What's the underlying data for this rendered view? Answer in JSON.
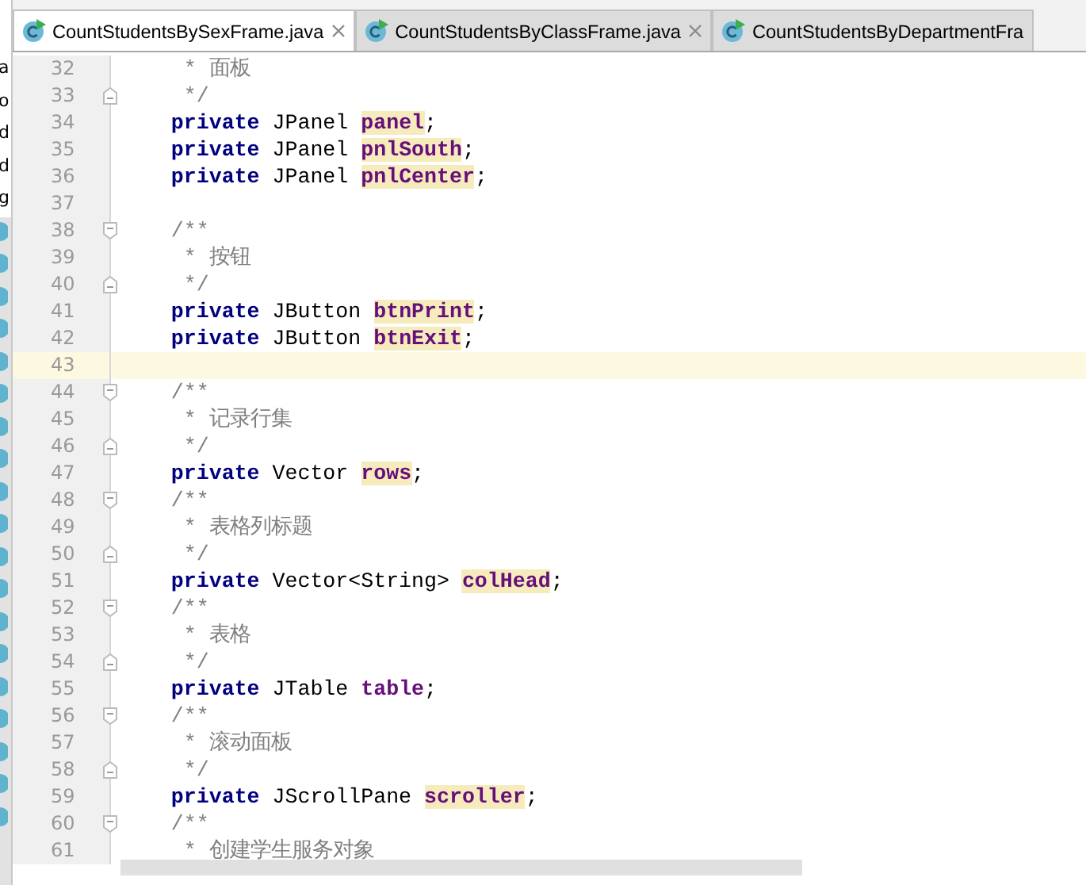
{
  "project_panel": {
    "items": [
      {
        "kind": "text",
        "label": "a"
      },
      {
        "kind": "text",
        "label": "o"
      },
      {
        "kind": "text",
        "label": "d"
      },
      {
        "kind": "text",
        "label": "d"
      },
      {
        "kind": "text",
        "label": "g"
      },
      {
        "kind": "icon"
      },
      {
        "kind": "icon"
      },
      {
        "kind": "icon"
      },
      {
        "kind": "icon"
      },
      {
        "kind": "icon"
      },
      {
        "kind": "icon"
      },
      {
        "kind": "icon"
      },
      {
        "kind": "icon"
      },
      {
        "kind": "icon"
      },
      {
        "kind": "icon"
      },
      {
        "kind": "icon"
      },
      {
        "kind": "icon"
      },
      {
        "kind": "icon"
      },
      {
        "kind": "icon"
      },
      {
        "kind": "icon"
      },
      {
        "kind": "icon"
      },
      {
        "kind": "icon"
      },
      {
        "kind": "icon"
      },
      {
        "kind": "icon"
      }
    ]
  },
  "tabs": [
    {
      "label": "CountStudentsBySexFrame.java",
      "selected": true,
      "closable": true
    },
    {
      "label": "CountStudentsByClassFrame.java",
      "selected": false,
      "closable": true
    },
    {
      "label": "CountStudentsByDepartmentFra",
      "selected": false,
      "closable": false
    }
  ],
  "lines": [
    {
      "number": "32",
      "current": false,
      "fold_start": false,
      "fold_end": false,
      "tokens": [
        {
          "kind": "comment",
          "text": "     * 面板"
        }
      ]
    },
    {
      "number": "33",
      "current": false,
      "fold_start": false,
      "fold_end": true,
      "tokens": [
        {
          "kind": "comment",
          "text": "     */"
        }
      ]
    },
    {
      "number": "34",
      "current": false,
      "fold_start": false,
      "fold_end": false,
      "tokens": [
        {
          "kind": "keyword",
          "text": "    private"
        },
        {
          "kind": "text",
          "text": " JPanel "
        },
        {
          "kind": "field-hl",
          "text": "panel"
        },
        {
          "kind": "text",
          "text": ";"
        }
      ]
    },
    {
      "number": "35",
      "current": false,
      "fold_start": false,
      "fold_end": false,
      "tokens": [
        {
          "kind": "keyword",
          "text": "    private"
        },
        {
          "kind": "text",
          "text": " JPanel "
        },
        {
          "kind": "field-hl",
          "text": "pnlSouth"
        },
        {
          "kind": "text",
          "text": ";"
        }
      ]
    },
    {
      "number": "36",
      "current": false,
      "fold_start": false,
      "fold_end": false,
      "tokens": [
        {
          "kind": "keyword",
          "text": "    private"
        },
        {
          "kind": "text",
          "text": " JPanel "
        },
        {
          "kind": "field-hl",
          "text": "pnlCenter"
        },
        {
          "kind": "text",
          "text": ";"
        }
      ]
    },
    {
      "number": "37",
      "current": false,
      "fold_start": false,
      "fold_end": false
    },
    {
      "number": "38",
      "current": false,
      "fold_start": true,
      "fold_end": false,
      "tokens": [
        {
          "kind": "comment",
          "text": "    /**"
        }
      ]
    },
    {
      "number": "39",
      "current": false,
      "fold_start": false,
      "fold_end": false,
      "tokens": [
        {
          "kind": "comment",
          "text": "     * 按钮"
        }
      ]
    },
    {
      "number": "40",
      "current": false,
      "fold_start": false,
      "fold_end": true,
      "tokens": [
        {
          "kind": "comment",
          "text": "     */"
        }
      ]
    },
    {
      "number": "41",
      "current": false,
      "fold_start": false,
      "fold_end": false,
      "tokens": [
        {
          "kind": "keyword",
          "text": "    private"
        },
        {
          "kind": "text",
          "text": " JButton "
        },
        {
          "kind": "field-hl",
          "text": "btnPrint"
        },
        {
          "kind": "text",
          "text": ";"
        }
      ]
    },
    {
      "number": "42",
      "current": false,
      "fold_start": false,
      "fold_end": false,
      "tokens": [
        {
          "kind": "keyword",
          "text": "    private"
        },
        {
          "kind": "text",
          "text": " JButton "
        },
        {
          "kind": "field-hl",
          "text": "btnExit"
        },
        {
          "kind": "text",
          "text": ";"
        }
      ]
    },
    {
      "number": "43",
      "current": true,
      "fold_start": false,
      "fold_end": false
    },
    {
      "number": "44",
      "current": false,
      "fold_start": true,
      "fold_end": false,
      "tokens": [
        {
          "kind": "comment",
          "text": "    /**"
        }
      ]
    },
    {
      "number": "45",
      "current": false,
      "fold_start": false,
      "fold_end": false,
      "tokens": [
        {
          "kind": "comment",
          "text": "     * 记录行集"
        }
      ]
    },
    {
      "number": "46",
      "current": false,
      "fold_start": false,
      "fold_end": true,
      "tokens": [
        {
          "kind": "comment",
          "text": "     */"
        }
      ]
    },
    {
      "number": "47",
      "current": false,
      "fold_start": false,
      "fold_end": false,
      "tokens": [
        {
          "kind": "keyword",
          "text": "    private"
        },
        {
          "kind": "text",
          "text": " Vector "
        },
        {
          "kind": "field-hl",
          "text": "rows"
        },
        {
          "kind": "text",
          "text": ";"
        }
      ]
    },
    {
      "number": "48",
      "current": false,
      "fold_start": true,
      "fold_end": false,
      "tokens": [
        {
          "kind": "comment",
          "text": "    /**"
        }
      ]
    },
    {
      "number": "49",
      "current": false,
      "fold_start": false,
      "fold_end": false,
      "tokens": [
        {
          "kind": "comment",
          "text": "     * 表格列标题"
        }
      ]
    },
    {
      "number": "50",
      "current": false,
      "fold_start": false,
      "fold_end": true,
      "tokens": [
        {
          "kind": "comment",
          "text": "     */"
        }
      ]
    },
    {
      "number": "51",
      "current": false,
      "fold_start": false,
      "fold_end": false,
      "tokens": [
        {
          "kind": "keyword",
          "text": "    private"
        },
        {
          "kind": "text",
          "text": " Vector<String> "
        },
        {
          "kind": "field-hl",
          "text": "colHead"
        },
        {
          "kind": "text",
          "text": ";"
        }
      ]
    },
    {
      "number": "52",
      "current": false,
      "fold_start": true,
      "fold_end": false,
      "tokens": [
        {
          "kind": "comment",
          "text": "    /**"
        }
      ]
    },
    {
      "number": "53",
      "current": false,
      "fold_start": false,
      "fold_end": false,
      "tokens": [
        {
          "kind": "comment",
          "text": "     * 表格"
        }
      ]
    },
    {
      "number": "54",
      "current": false,
      "fold_start": false,
      "fold_end": true,
      "tokens": [
        {
          "kind": "comment",
          "text": "     */"
        }
      ]
    },
    {
      "number": "55",
      "current": false,
      "fold_start": false,
      "fold_end": false,
      "tokens": [
        {
          "kind": "keyword",
          "text": "    private"
        },
        {
          "kind": "text",
          "text": " JTable "
        },
        {
          "kind": "field",
          "text": "table"
        },
        {
          "kind": "text",
          "text": ";"
        }
      ]
    },
    {
      "number": "56",
      "current": false,
      "fold_start": true,
      "fold_end": false,
      "tokens": [
        {
          "kind": "comment",
          "text": "    /**"
        }
      ]
    },
    {
      "number": "57",
      "current": false,
      "fold_start": false,
      "fold_end": false,
      "tokens": [
        {
          "kind": "comment",
          "text": "     * 滚动面板"
        }
      ]
    },
    {
      "number": "58",
      "current": false,
      "fold_start": false,
      "fold_end": true,
      "tokens": [
        {
          "kind": "comment",
          "text": "     */"
        }
      ]
    },
    {
      "number": "59",
      "current": false,
      "fold_start": false,
      "fold_end": false,
      "tokens": [
        {
          "kind": "keyword",
          "text": "    private"
        },
        {
          "kind": "text",
          "text": " JScrollPane "
        },
        {
          "kind": "field-hl",
          "text": "scroller"
        },
        {
          "kind": "text",
          "text": ";"
        }
      ]
    },
    {
      "number": "60",
      "current": false,
      "fold_start": true,
      "fold_end": false,
      "tokens": [
        {
          "kind": "comment",
          "text": "    /**"
        }
      ]
    },
    {
      "number": "61",
      "current": false,
      "fold_start": false,
      "fold_end": false,
      "tokens": [
        {
          "kind": "comment",
          "text": "     * 创建学生服务对象"
        }
      ]
    }
  ]
}
